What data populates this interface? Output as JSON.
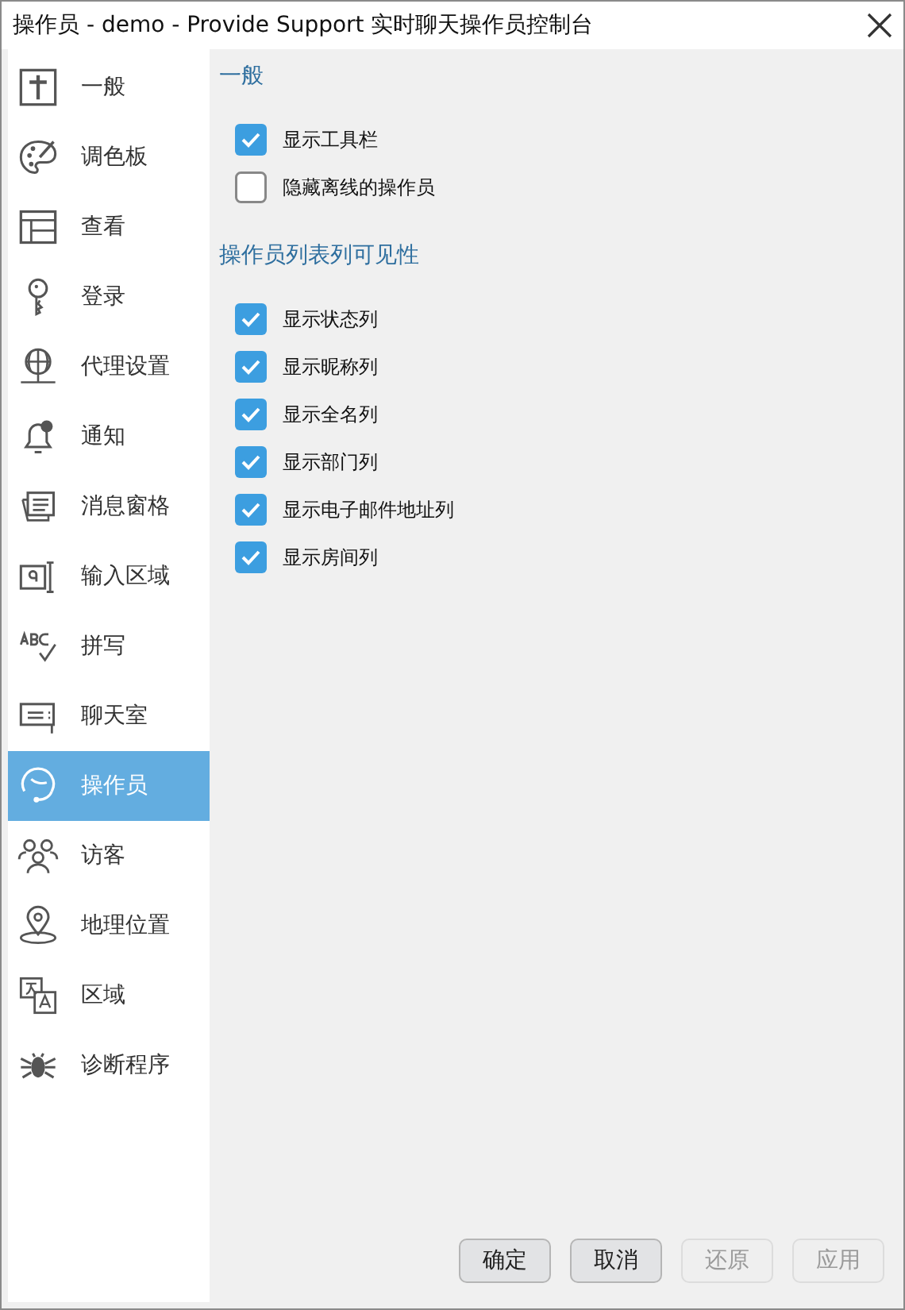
{
  "window": {
    "title": "操作员 - demo - Provide Support 实时聊天操作员控制台"
  },
  "sidebar": {
    "items": [
      {
        "label": "一般",
        "selected": false
      },
      {
        "label": "调色板",
        "selected": false
      },
      {
        "label": "查看",
        "selected": false
      },
      {
        "label": "登录",
        "selected": false
      },
      {
        "label": "代理设置",
        "selected": false
      },
      {
        "label": "通知",
        "selected": false
      },
      {
        "label": "消息窗格",
        "selected": false
      },
      {
        "label": "输入区域",
        "selected": false
      },
      {
        "label": "拼写",
        "selected": false
      },
      {
        "label": "聊天室",
        "selected": false
      },
      {
        "label": "操作员",
        "selected": true
      },
      {
        "label": "访客",
        "selected": false
      },
      {
        "label": "地理位置",
        "selected": false
      },
      {
        "label": "区域",
        "selected": false
      },
      {
        "label": "诊断程序",
        "selected": false
      }
    ]
  },
  "sections": [
    {
      "title": "一般",
      "options": [
        {
          "label": "显示工具栏",
          "checked": true
        },
        {
          "label": "隐藏离线的操作员",
          "checked": false
        }
      ]
    },
    {
      "title": "操作员列表列可见性",
      "options": [
        {
          "label": "显示状态列",
          "checked": true
        },
        {
          "label": "显示昵称列",
          "checked": true
        },
        {
          "label": "显示全名列",
          "checked": true
        },
        {
          "label": "显示部门列",
          "checked": true
        },
        {
          "label": "显示电子邮件地址列",
          "checked": true
        },
        {
          "label": "显示房间列",
          "checked": true
        }
      ]
    }
  ],
  "buttons": [
    {
      "label": "确定",
      "disabled": false
    },
    {
      "label": "取消",
      "disabled": false
    },
    {
      "label": "还原",
      "disabled": true
    },
    {
      "label": "应用",
      "disabled": true
    }
  ]
}
